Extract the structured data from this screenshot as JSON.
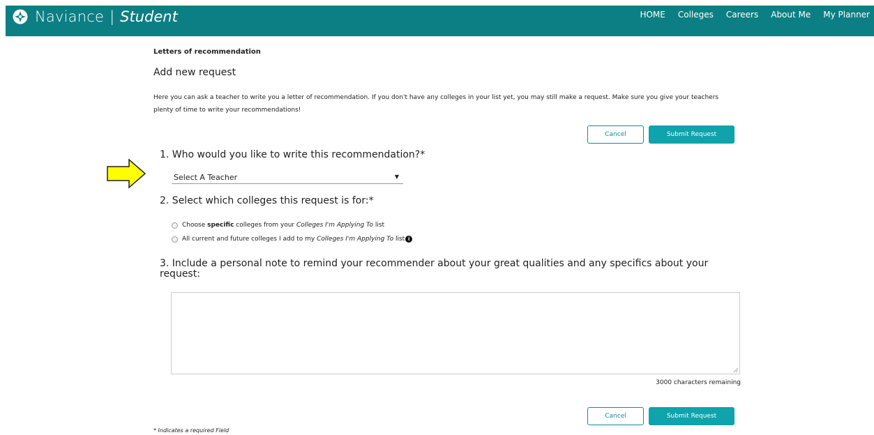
{
  "header": {
    "brand": "Naviance",
    "separator": "|",
    "product": "Student",
    "nav": [
      "HOME",
      "Colleges",
      "Careers",
      "About Me",
      "My Planner"
    ],
    "bg_color": "#0c7f84"
  },
  "breadcrumb": "Letters of recommendation",
  "title": "Add new request",
  "intro": "Here you can ask a teacher to write you a letter of recommendation. If you don't have any colleges in your list yet, you may still make a request. Make sure you give your teachers plenty of time to write your recommendations!",
  "actions": {
    "cancel": "Cancel",
    "submit": "Submit Request",
    "accent": "#0fa3ac"
  },
  "q1": {
    "label": "1. Who would you like to write this recommendation?*",
    "selected": "Select A Teacher"
  },
  "q2": {
    "label": "2. Select which colleges this request is for:*",
    "opt1_pre": "Choose ",
    "opt1_bold": "specific",
    "opt1_mid": " colleges from your ",
    "opt1_italic": "Colleges I'm Applying To",
    "opt1_post": " list",
    "opt2_pre": "All current and future colleges I add to my ",
    "opt2_italic": "Colleges I'm Applying To",
    "opt2_post": " list",
    "info_icon": "i"
  },
  "q3": {
    "label": "3. Include a personal note to remind your recommender about your great qualities and any specifics about your request:"
  },
  "remaining": "3000 characters remaining",
  "required_note": "* Indicates a required Field",
  "annotation": {
    "icon": "arrow-right-icon",
    "color": "#ffff00"
  }
}
